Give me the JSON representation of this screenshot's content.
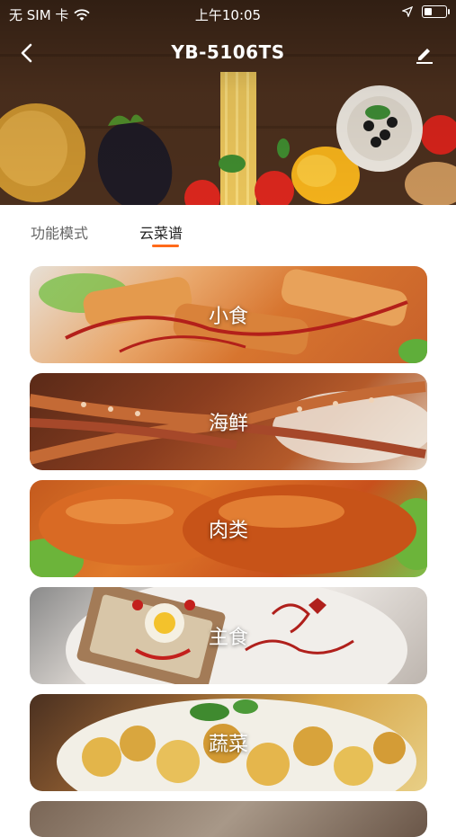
{
  "status_bar": {
    "carrier": "无 SIM 卡",
    "time": "上午10:05"
  },
  "header": {
    "title": "YB-5106TS"
  },
  "tabs": [
    {
      "label": "功能模式",
      "active": false
    },
    {
      "label": "云菜谱",
      "active": true
    }
  ],
  "categories": [
    {
      "label": "小食"
    },
    {
      "label": "海鲜"
    },
    {
      "label": "肉类"
    },
    {
      "label": "主食"
    },
    {
      "label": "蔬菜"
    }
  ],
  "colors": {
    "accent": "#ff6a1a",
    "tab_active": "#222222",
    "tab_inactive": "#666666"
  }
}
